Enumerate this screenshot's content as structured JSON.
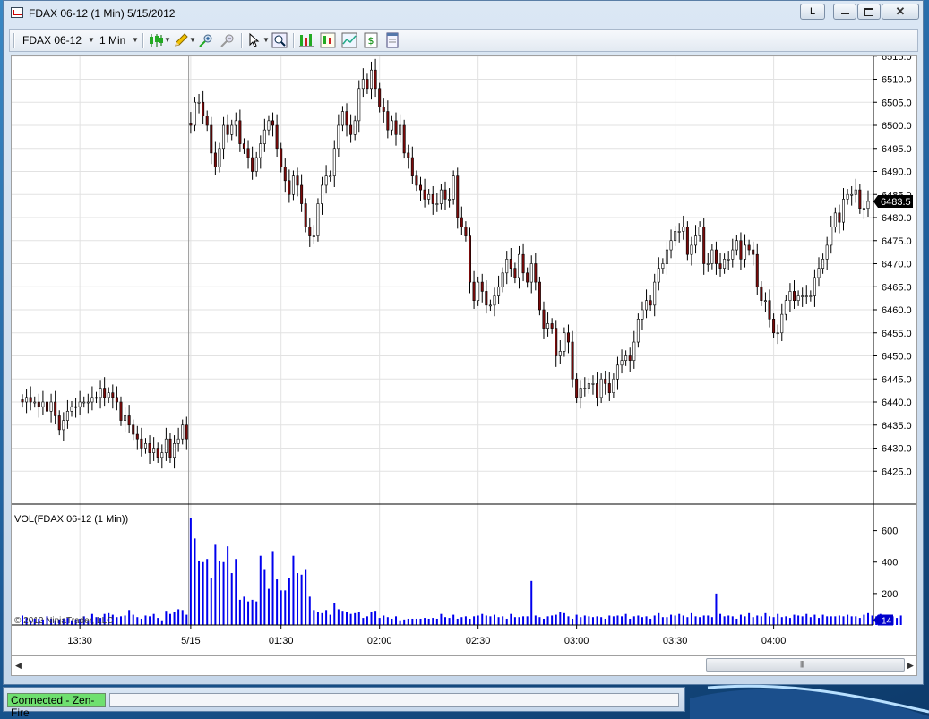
{
  "window": {
    "title": "FDAX 06-12 (1 Min)  5/15/2012",
    "link_button": "L"
  },
  "toolbar": {
    "instrument": "FDAX 06-12",
    "interval": "1 Min",
    "icons": [
      "candlestick-style-icon",
      "draw-pencil-icon",
      "zoom-in-icon",
      "zoom-out-icon",
      "cursor-icon",
      "magnify-icon",
      "strategy-icon",
      "bar-type-icon",
      "indicators-icon",
      "trade-icon",
      "properties-icon"
    ]
  },
  "status": {
    "connection": "Connected - Zen-Fire",
    "connection_color": "#6fe06f"
  },
  "colors": {
    "up_candle": "#ffffff",
    "down_candle": "#7a0a0a",
    "wick": "#000000",
    "volume_bar": "#0000ee",
    "grid": "#e2e2e2",
    "last_price_bg": "#000000",
    "volume_tag_bg": "#0000cc"
  },
  "chart_data": [
    {
      "type": "candlestick",
      "instrument": "FDAX 06-12",
      "interval": "1 Min",
      "date": "5/15/2012",
      "ylim": [
        6422,
        6518
      ],
      "y_ticks": [
        "6515.0",
        "6510.0",
        "6505.0",
        "6500.0",
        "6495.0",
        "6490.0",
        "6485.0",
        "6480.0",
        "6475.0",
        "6470.0",
        "6465.0",
        "6460.0",
        "6455.0",
        "6450.0",
        "6445.0",
        "6440.0",
        "6435.0",
        "6430.0",
        "6425.0"
      ],
      "y_tick_values": [
        6515,
        6510,
        6505,
        6500,
        6495,
        6490,
        6485,
        6480,
        6475,
        6470,
        6465,
        6460,
        6455,
        6450,
        6445,
        6440,
        6435,
        6430,
        6425
      ],
      "x_ticks": [
        "13:30",
        "5/15",
        "01:30",
        "02:00",
        "02:30",
        "03:00",
        "03:30",
        "04:00"
      ],
      "last_price": "6483.5",
      "copyright": "© 2012 NinjaTrader, LLC",
      "session_break_label": "5/15",
      "closes": [
        6440,
        6441,
        6440,
        6440,
        6439,
        6440,
        6438,
        6440,
        6437,
        6434,
        6436,
        6438,
        6439,
        6439,
        6440,
        6440,
        6440,
        6441,
        6441,
        6443,
        6441,
        6442,
        6441,
        6440,
        6436,
        6437,
        6435,
        6433,
        6432,
        6430,
        6431,
        6429,
        6430,
        6428,
        6429,
        6432,
        6428,
        6431,
        6432,
        6435,
        6432,
        6500,
        6505,
        6505,
        6502,
        6500,
        6494,
        6491,
        6495,
        6500,
        6498,
        6500,
        6501,
        6496,
        6495,
        6493,
        6490,
        6493,
        6496,
        6499,
        6501,
        6500,
        6495,
        6491,
        6488,
        6485,
        6489,
        6487,
        6483,
        6478,
        6476,
        6476,
        6483,
        6487,
        6489,
        6489,
        6495,
        6500,
        6503,
        6500,
        6498,
        6501,
        6508,
        6510,
        6508,
        6512,
        6508,
        6504,
        6503,
        6499,
        6501,
        6498,
        6500,
        6494,
        6493,
        6489,
        6487,
        6486,
        6484,
        6485,
        6483,
        6483,
        6486,
        6484,
        6484,
        6489,
        6480,
        6478,
        6476,
        6466,
        6462,
        6466,
        6464,
        6461,
        6461,
        6463,
        6465,
        6468,
        6471,
        6469,
        6467,
        6472,
        6468,
        6466,
        6470,
        6466,
        6460,
        6456,
        6457,
        6456,
        6450,
        6451,
        6455,
        6453,
        6445,
        6441,
        6443,
        6443,
        6444,
        6444,
        6441,
        6445,
        6444,
        6442,
        6445,
        6448,
        6449,
        6450,
        6449,
        6453,
        6458,
        6460,
        6462,
        6461,
        6466,
        6469,
        6470,
        6473,
        6475,
        6477,
        6477,
        6478,
        6472,
        6474,
        6476,
        6478,
        6470,
        6470,
        6473,
        6470,
        6469,
        6471,
        6471,
        6473,
        6475,
        6471,
        6474,
        6473,
        6472,
        6465,
        6462,
        6462,
        6458,
        6455,
        6455,
        6459,
        6462,
        6464,
        6462,
        6463,
        6463,
        6463,
        6463,
        6467,
        6469,
        6471,
        6474,
        6478,
        6481,
        6479,
        6484,
        6485,
        6485,
        6486,
        6482,
        6482,
        6483.5
      ]
    },
    {
      "type": "bar",
      "title": "VOL(FDAX 06-12 (1 Min))",
      "ylim": [
        0,
        740
      ],
      "y_ticks": [
        "600",
        "400",
        "200"
      ],
      "y_tick_values": [
        600,
        400,
        200
      ],
      "last_value": "14",
      "values": [
        60,
        45,
        30,
        40,
        40,
        35,
        55,
        40,
        30,
        35,
        40,
        45,
        30,
        35,
        40,
        55,
        30,
        70,
        50,
        45,
        70,
        75,
        65,
        50,
        55,
        60,
        95,
        65,
        50,
        40,
        60,
        55,
        70,
        45,
        30,
        90,
        70,
        85,
        100,
        95,
        65,
        680,
        550,
        410,
        400,
        420,
        300,
        510,
        410,
        400,
        500,
        330,
        420,
        160,
        180,
        150,
        160,
        150,
        440,
        350,
        230,
        470,
        290,
        220,
        220,
        300,
        440,
        330,
        320,
        350,
        180,
        95,
        80,
        75,
        95,
        65,
        140,
        100,
        90,
        80,
        70,
        75,
        80,
        45,
        55,
        80,
        90,
        45,
        60,
        50,
        40,
        55,
        30,
        35,
        40,
        40,
        40,
        40,
        45,
        40,
        45,
        40,
        70,
        50,
        45,
        65,
        40,
        50,
        55,
        40,
        55,
        60,
        70,
        60,
        55,
        65,
        50,
        55,
        40,
        70,
        50,
        50,
        55,
        55,
        280,
        60,
        50,
        40,
        55,
        60,
        65,
        80,
        75,
        55,
        40,
        65,
        50,
        60,
        55,
        50,
        55,
        50,
        40,
        60,
        55,
        60,
        55,
        70,
        40,
        55,
        60,
        50,
        55,
        40,
        60,
        75,
        50,
        50,
        65,
        60,
        70,
        60,
        50,
        75,
        55,
        50,
        60,
        60,
        50,
        200,
        70,
        55,
        60,
        55,
        40,
        65,
        55,
        75,
        50,
        60,
        55,
        75,
        55,
        50,
        70,
        50,
        55,
        45,
        65,
        60,
        55,
        70,
        50,
        65,
        45,
        65,
        55,
        55,
        55,
        60,
        55,
        65,
        55,
        55,
        45,
        65,
        75,
        60,
        55,
        70,
        50,
        60,
        55,
        45,
        60
      ]
    }
  ]
}
